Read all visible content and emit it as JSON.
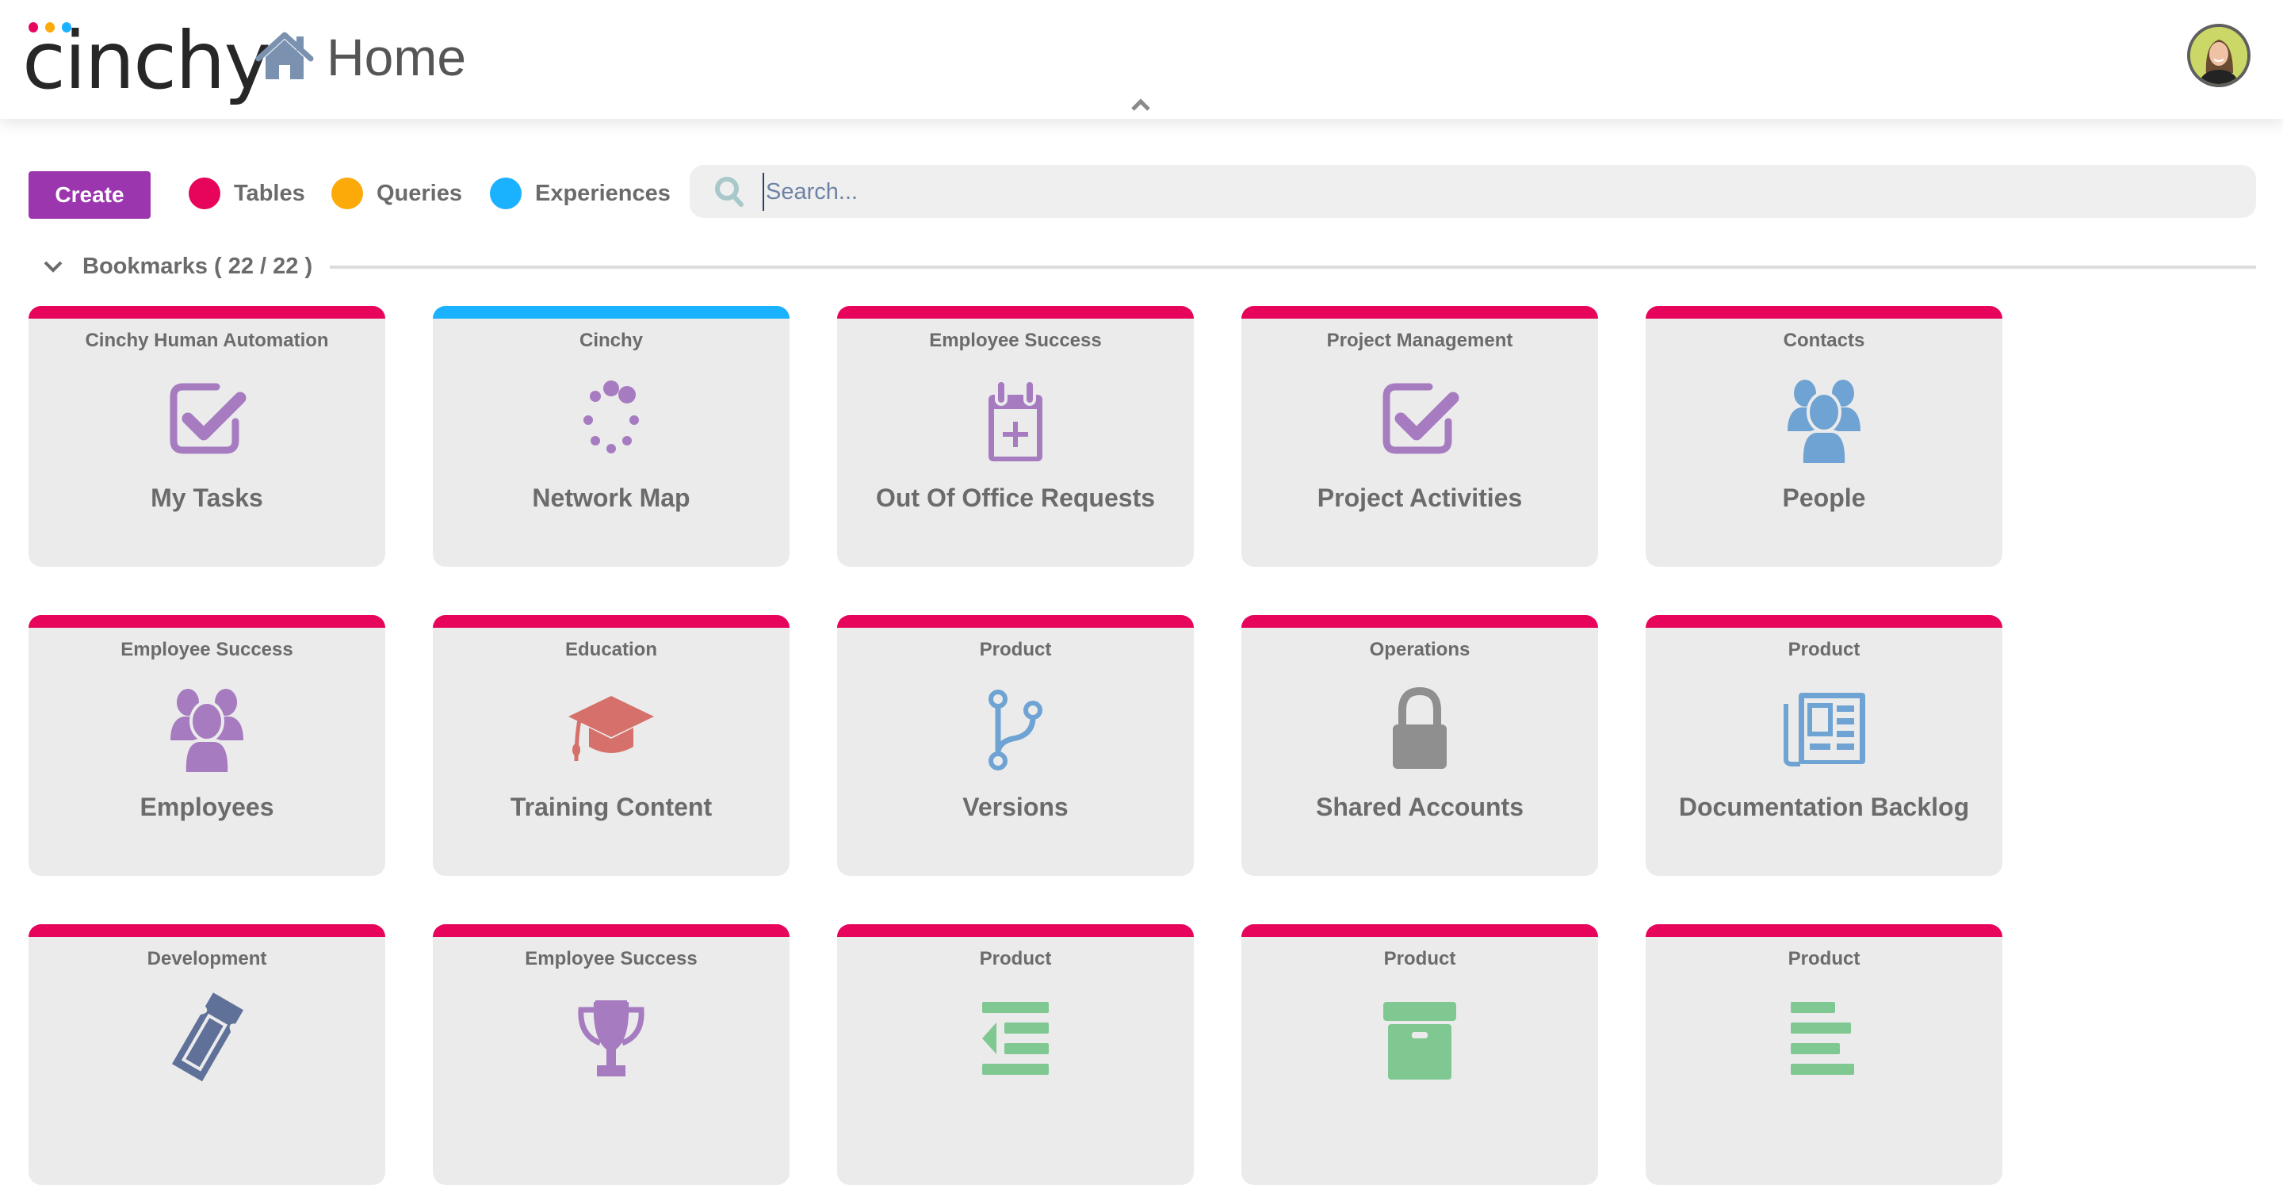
{
  "app": {
    "logo_text": "cinchy",
    "logo_dot_colors": [
      "#e6065c",
      "#fbaa0a",
      "#1ab2ff"
    ],
    "page_title": "Home",
    "home_icon": "home-icon",
    "avatar_alt": "User avatar"
  },
  "toolbar": {
    "create_label": "Create",
    "filters": [
      {
        "label": "Tables",
        "color": "#e6055b"
      },
      {
        "label": "Queries",
        "color": "#fcaa0a"
      },
      {
        "label": "Experiences",
        "color": "#1ab2fe"
      }
    ],
    "search": {
      "placeholder": "Search...",
      "value": ""
    }
  },
  "bookmarks": {
    "title": "Bookmarks ( 22 / 22 )",
    "shown": 22,
    "total": 22,
    "cards": [
      {
        "category": "Cinchy Human Automation",
        "title": "My Tasks",
        "type": "table",
        "icon": "checkbox-icon",
        "icon_color": "#a67bc0"
      },
      {
        "category": "Cinchy",
        "title": "Network Map",
        "type": "experience",
        "icon": "spinner-icon",
        "icon_color": "#a67bc0"
      },
      {
        "category": "Employee Success",
        "title": "Out Of Office Requests",
        "type": "table",
        "icon": "calendar-plus-icon",
        "icon_color": "#a67bc0"
      },
      {
        "category": "Project Management",
        "title": "Project Activities",
        "type": "table",
        "icon": "checkbox-icon",
        "icon_color": "#a67bc0"
      },
      {
        "category": "Contacts",
        "title": "People",
        "type": "table",
        "icon": "users-icon",
        "icon_color": "#6fa3d3"
      },
      {
        "category": "Employee Success",
        "title": "Employees",
        "type": "table",
        "icon": "users-icon",
        "icon_color": "#a67bc0"
      },
      {
        "category": "Education",
        "title": "Training Content",
        "type": "table",
        "icon": "graduation-cap-icon",
        "icon_color": "#d6706a"
      },
      {
        "category": "Product",
        "title": "Versions",
        "type": "table",
        "icon": "code-branch-icon",
        "icon_color": "#6fa3d3"
      },
      {
        "category": "Operations",
        "title": "Shared Accounts",
        "type": "table",
        "icon": "lock-icon",
        "icon_color": "#8f8f8f"
      },
      {
        "category": "Product",
        "title": "Documentation Backlog",
        "type": "table",
        "icon": "newspaper-icon",
        "icon_color": "#6fa3d3"
      },
      {
        "category": "Development",
        "title": "",
        "type": "table",
        "icon": "ticket-icon",
        "icon_color": "#5f7199"
      },
      {
        "category": "Employee Success",
        "title": "",
        "type": "table",
        "icon": "trophy-icon",
        "icon_color": "#a67bc0"
      },
      {
        "category": "Product",
        "title": "",
        "type": "table",
        "icon": "outdent-icon",
        "icon_color": "#7fc891"
      },
      {
        "category": "Product",
        "title": "",
        "type": "table",
        "icon": "archive-icon",
        "icon_color": "#7fc891"
      },
      {
        "category": "Product",
        "title": "",
        "type": "table",
        "icon": "align-left-icon",
        "icon_color": "#7fc891"
      }
    ]
  },
  "type_colors": {
    "table": "#e6055b",
    "query": "#fcaa0a",
    "experience": "#1ab2fe"
  }
}
